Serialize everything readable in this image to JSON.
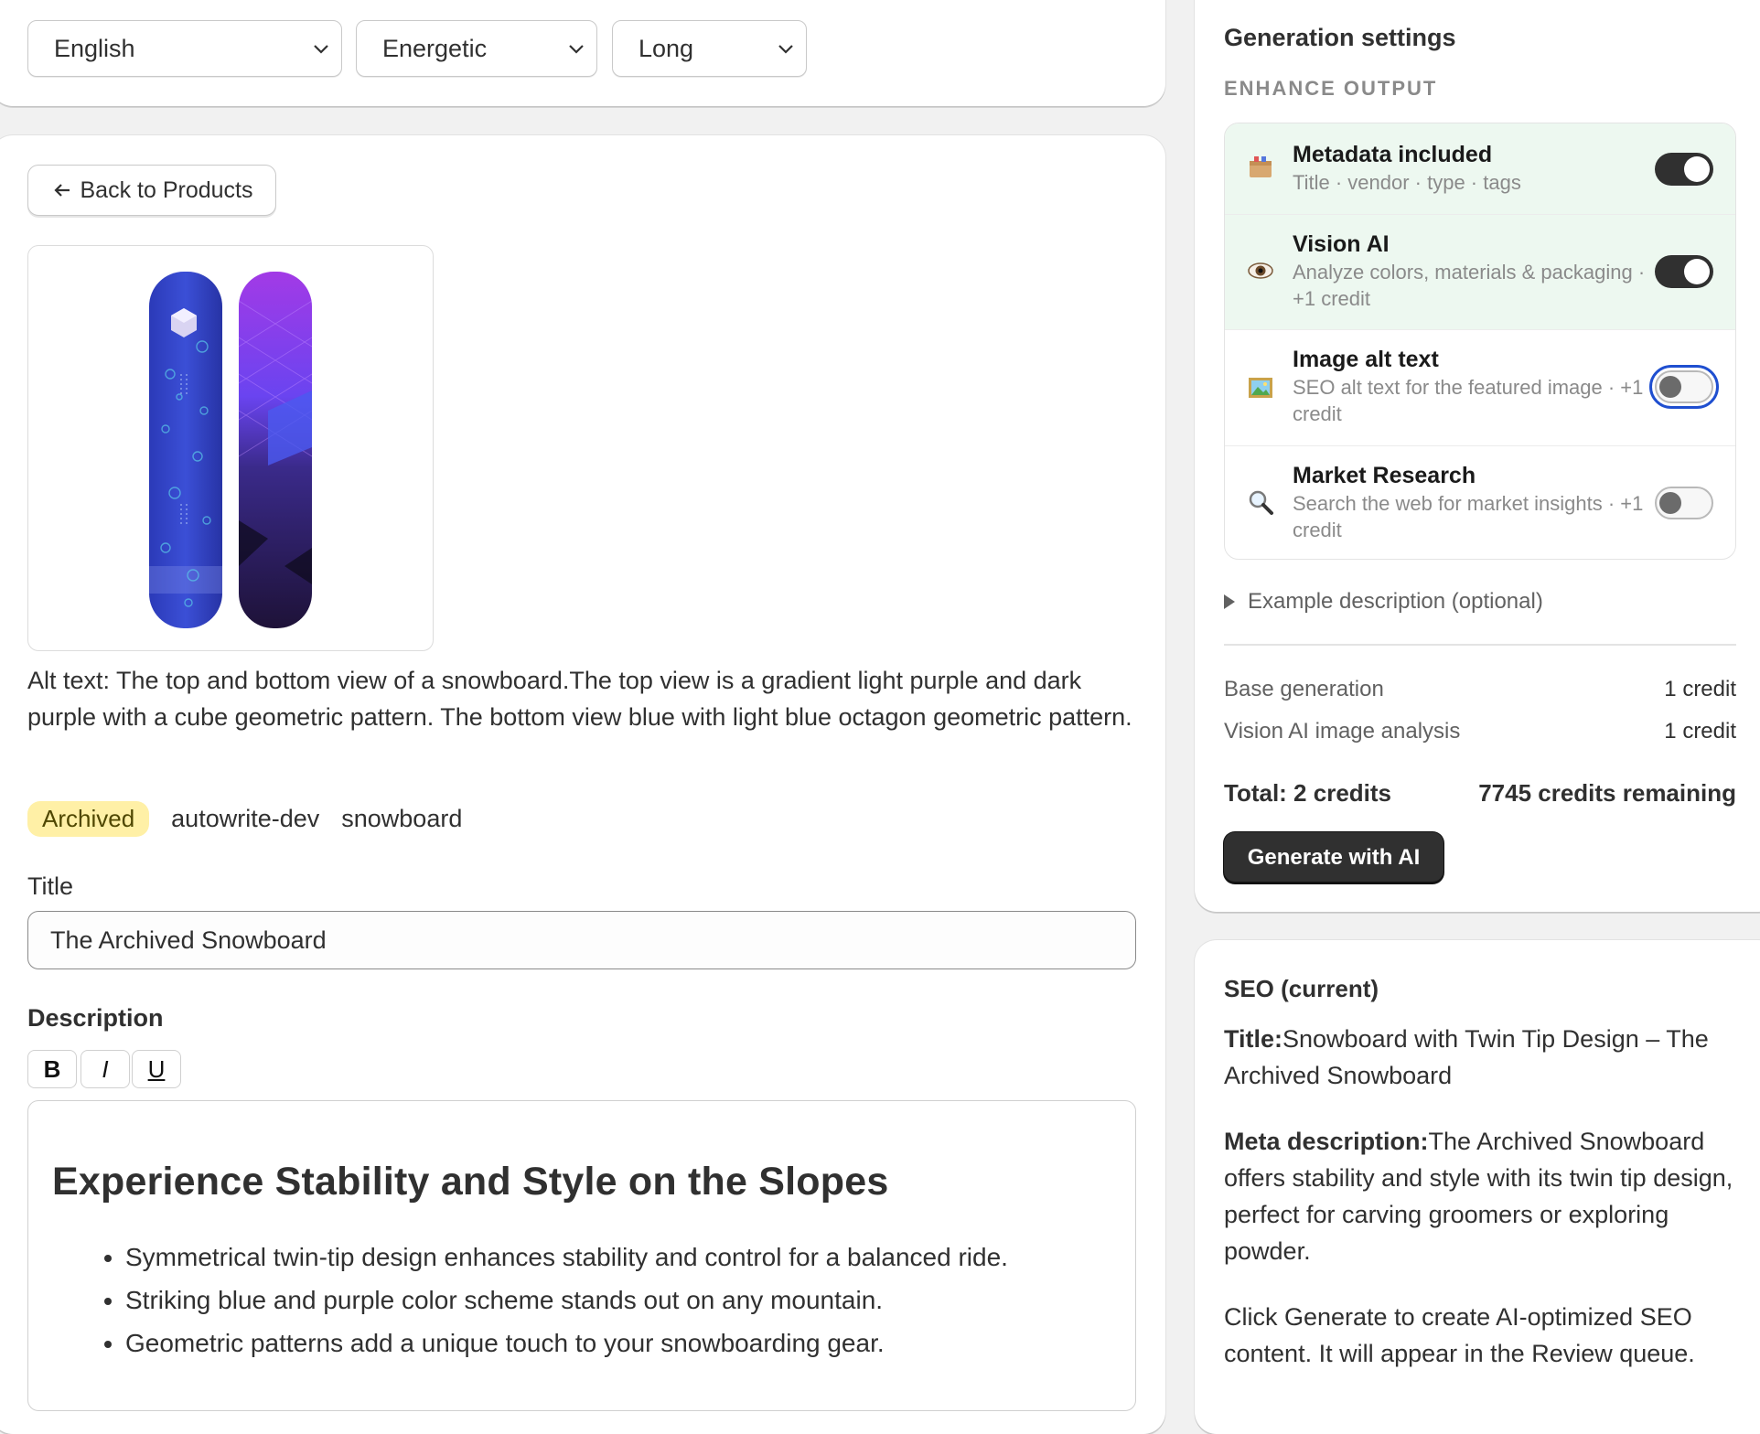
{
  "toolbar": {
    "language": "English",
    "tone": "Energetic",
    "length": "Long"
  },
  "product": {
    "back_label": "Back to Products",
    "image_icon": "snowboard-product-image",
    "alt_text": "Alt text: The top and bottom view of a snowboard.The top view is a gradient light purple and dark purple with a cube geometric pattern. The bottom view blue with light blue octagon geometric pattern.",
    "status_badge": "Archived",
    "tags": [
      "autowrite-dev",
      "snowboard"
    ],
    "title_label": "Title",
    "title_value": "The Archived Snowboard",
    "description_label": "Description",
    "format_buttons": {
      "bold": "B",
      "italic": "I",
      "underline": "U"
    },
    "description": {
      "heading": "Experience Stability and Style on the Slopes",
      "bullets": [
        "Symmetrical twin-tip design enhances stability and control for a balanced ride.",
        "Striking blue and purple color scheme stands out on any mountain.",
        "Geometric patterns add a unique touch to your snowboarding gear."
      ]
    }
  },
  "settings": {
    "title": "Generation settings",
    "section": "ENHANCE OUTPUT",
    "options": [
      {
        "title": "Metadata included",
        "subtitle": "Title · vendor · type · tags",
        "icon": "box-icon",
        "enabled": true
      },
      {
        "title": "Vision AI",
        "subtitle": "Analyze colors, materials & packaging · +1 credit",
        "icon": "eye-icon",
        "enabled": true
      },
      {
        "title": "Image alt text",
        "subtitle": "SEO alt text for the featured image · +1 credit",
        "icon": "picture-icon",
        "enabled": false
      },
      {
        "title": "Market Research",
        "subtitle": "Search the web for market insights · +1 credit",
        "icon": "magnifier-icon",
        "enabled": false
      }
    ],
    "example_toggle": "Example description (optional)",
    "costs": [
      {
        "label": "Base generation",
        "value": "1 credit"
      },
      {
        "label": "Vision AI image analysis",
        "value": "1 credit"
      }
    ],
    "total": "Total: 2 credits",
    "remaining": "7745 credits remaining",
    "generate_label": "Generate with AI",
    "colors": {
      "toggle_on": "#303030",
      "row_on_bg": "#edf8f0",
      "focus_ring": "#1f4fd0",
      "badge_bg": "#fff0a6"
    }
  },
  "seo": {
    "title": "SEO (current)",
    "title_label": "Title:",
    "title_value": "Snowboard with Twin Tip Design – The Archived Snowboard",
    "meta_label": "Meta description:",
    "meta_value": "The Archived Snowboard offers stability and style with its twin tip design, perfect for carving groomers or exploring powder.",
    "hint": "Click Generate to create AI-optimized SEO content. It will appear in the Review queue."
  }
}
